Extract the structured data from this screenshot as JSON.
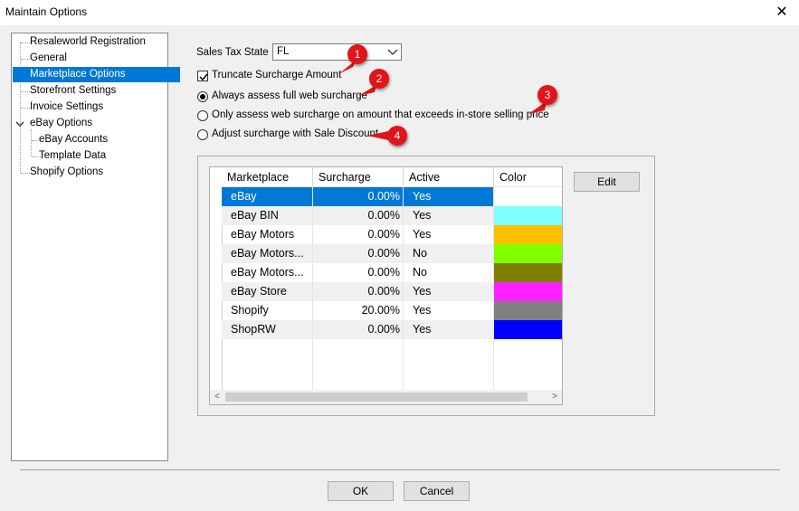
{
  "window": {
    "title": "Maintain Options",
    "close_glyph": "✕"
  },
  "tree": {
    "items": [
      {
        "label": "Resaleworld Registration"
      },
      {
        "label": "General"
      },
      {
        "label": "Marketplace Options"
      },
      {
        "label": "Storefront Settings"
      },
      {
        "label": "Invoice Settings"
      },
      {
        "label": "eBay Options"
      },
      {
        "label": "eBay Accounts"
      },
      {
        "label": "Template Data"
      },
      {
        "label": "Shopify Options"
      }
    ],
    "selected": "Marketplace Options"
  },
  "options": {
    "sales_tax_label": "Sales Tax State",
    "sales_tax_value": "FL",
    "truncate_label": "Truncate Surcharge Amount",
    "truncate_checked": true,
    "radio_always": "Always assess full web surcharge",
    "radio_only": "Only assess web surcharge on amount that exceeds in-store selling price",
    "radio_adjust": "Adjust surcharge with Sale Discount",
    "selected_radio": "Always assess full web surcharge"
  },
  "markers": [
    "1",
    "2",
    "3",
    "4"
  ],
  "grid": {
    "columns": [
      "Marketplace",
      "Surcharge",
      "Active",
      "Color"
    ],
    "rows": [
      {
        "marketplace": "eBay",
        "surcharge": "0.00%",
        "active": "Yes",
        "color": "#ffffff"
      },
      {
        "marketplace": "eBay BIN",
        "surcharge": "0.00%",
        "active": "Yes",
        "color": "#80ffff"
      },
      {
        "marketplace": "eBay Motors",
        "surcharge": "0.00%",
        "active": "Yes",
        "color": "#ffc000"
      },
      {
        "marketplace": "eBay Motors...",
        "surcharge": "0.00%",
        "active": "No",
        "color": "#80ff00"
      },
      {
        "marketplace": "eBay Motors...",
        "surcharge": "0.00%",
        "active": "No",
        "color": "#808000"
      },
      {
        "marketplace": "eBay Store",
        "surcharge": "0.00%",
        "active": "Yes",
        "color": "#ff20ff"
      },
      {
        "marketplace": "Shopify",
        "surcharge": "20.00%",
        "active": "Yes",
        "color": "#808080"
      },
      {
        "marketplace": "ShopRW",
        "surcharge": "0.00%",
        "active": "Yes",
        "color": "#0000ff"
      }
    ],
    "selected_row": "eBay",
    "scroll_left": "<",
    "scroll_right": ">"
  },
  "buttons": {
    "edit": "Edit",
    "ok": "OK",
    "cancel": "Cancel"
  },
  "colors": {
    "accent": "#0078d7",
    "marker": "#e0141a"
  }
}
